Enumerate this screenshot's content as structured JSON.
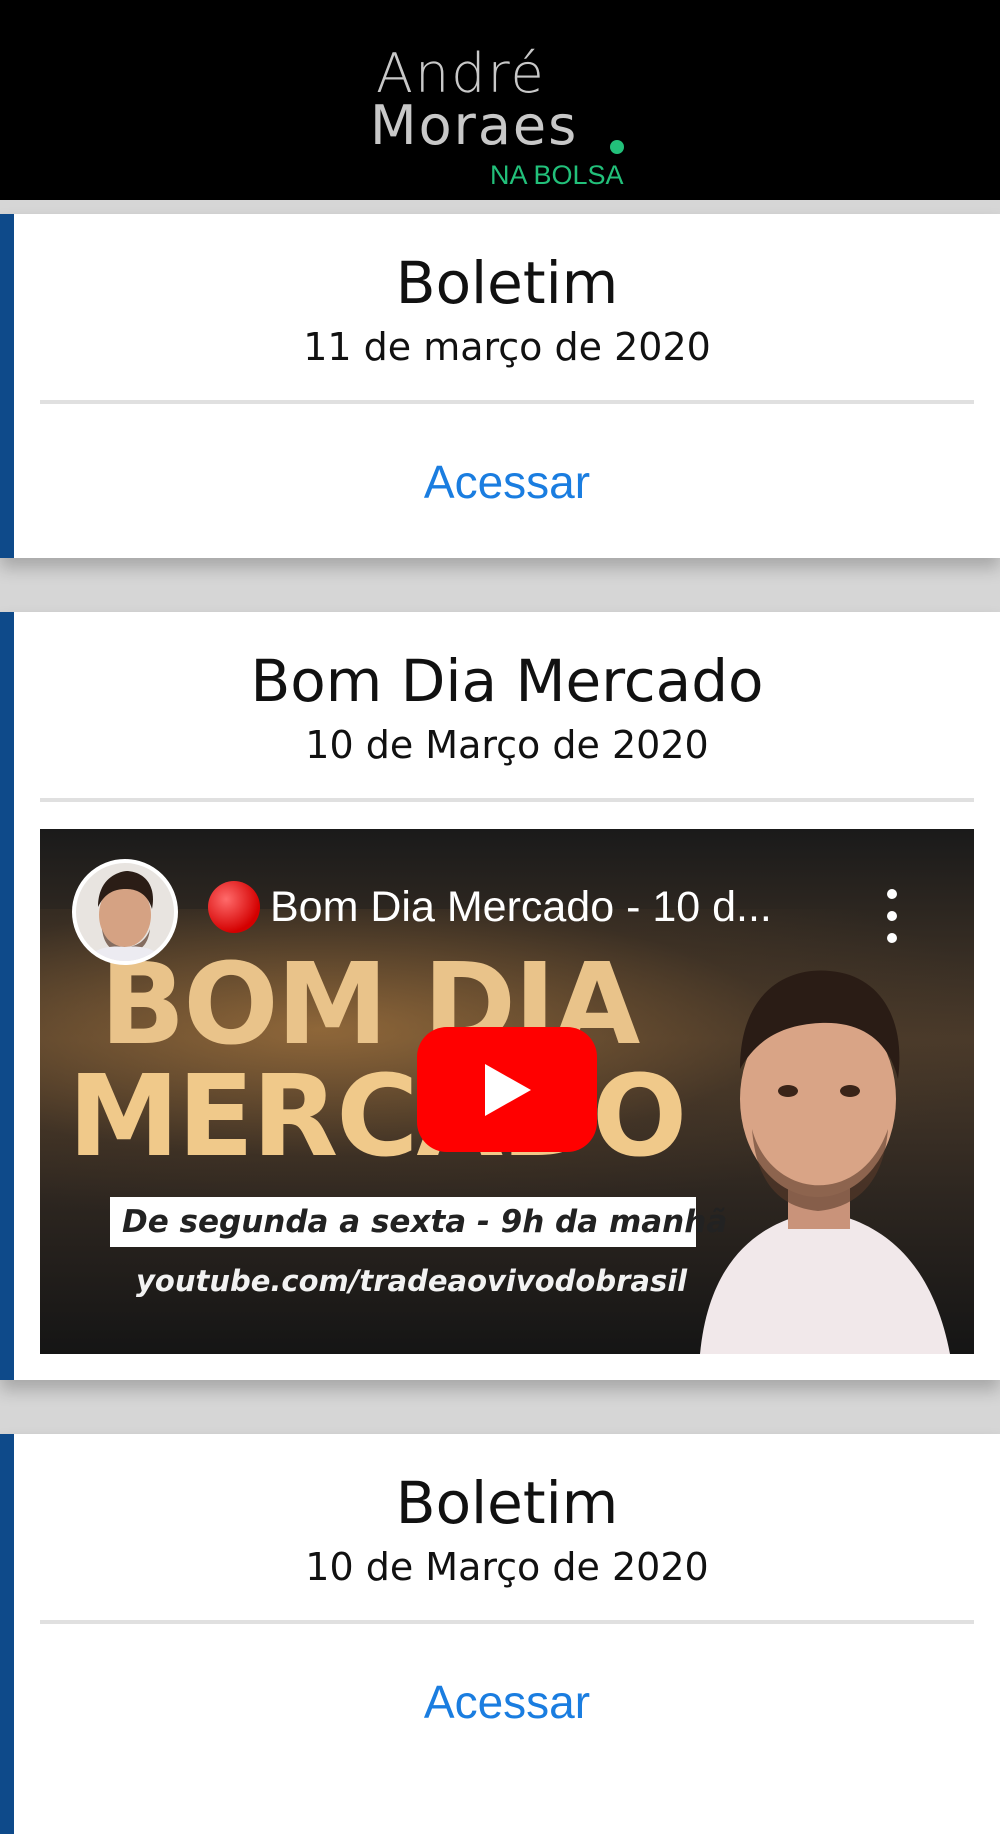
{
  "header": {
    "logo_line1": "André",
    "logo_line2": "Moraes",
    "logo_tagline": "NA BOLSA",
    "logo_dot_color": "#22c07a"
  },
  "cards": [
    {
      "type": "boletim",
      "title": "Boletim",
      "date": "11 de março de 2020",
      "link_label": "Acessar"
    },
    {
      "type": "video",
      "title": "Bom Dia Mercado",
      "date": "10 de Março de 2020",
      "video": {
        "title": "Bom Dia Mercado - 10 d...",
        "thumbnail_headline_1": "BOM DIA",
        "thumbnail_headline_2": "MERCADO",
        "thumbnail_schedule": "De segunda a sexta - 9h da manhã",
        "thumbnail_url": "youtube.com/tradeaovivodobrasil",
        "play_icon": "youtube-play-icon",
        "menu_icon": "more-vertical-icon"
      }
    },
    {
      "type": "boletim",
      "title": "Boletim",
      "date": "10 de Março de 2020",
      "link_label": "Acessar"
    }
  ],
  "colors": {
    "accent_bar": "#0e4a8a",
    "link": "#1a7de0",
    "header_bg": "#000000",
    "play_button": "#ff0000"
  }
}
